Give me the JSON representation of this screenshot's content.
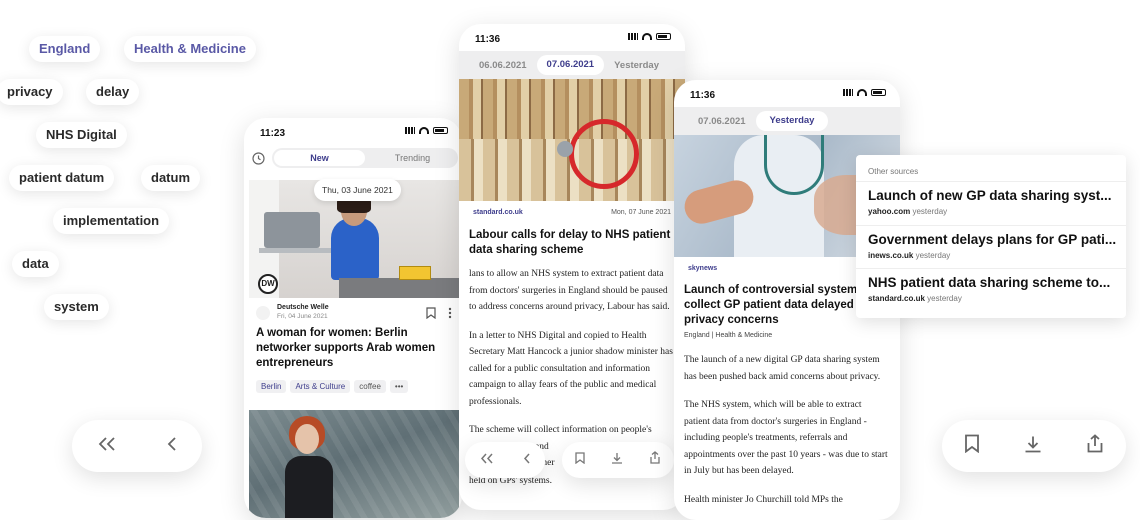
{
  "keywords": [
    "England",
    "Health & Medicine",
    "privacy",
    "delay",
    "NHS Digital",
    "patient datum",
    "datum",
    "implementation",
    "data",
    "system"
  ],
  "phone1": {
    "time": "11:23",
    "tabs": {
      "new": "New",
      "trending": "Trending"
    },
    "date_pill": "Thu, 03 June 2021",
    "source_name": "Deutsche Welle",
    "source_date": "Fri, 04 June 2021",
    "logo_text": "DW",
    "title": "A woman for women: Berlin networker supports Arab women entrepreneurs",
    "tags": [
      "Berlin",
      "Arts & Culture",
      "coffee",
      "•••"
    ]
  },
  "phone2": {
    "time": "11:36",
    "dates": [
      "06.06.2021",
      "07.06.2021",
      "Yesterday"
    ],
    "source": "standard.co.uk",
    "date": "Mon, 07 June 2021",
    "title": "Labour calls for delay to NHS patient data sharing scheme",
    "paragraphs": [
      "lans to allow an NHS system to extract patient data from doctors' surgeries in England should be paused to address concerns around privacy, Labour has said.",
      "In a letter to NHS Digital and copied to Health Secretary Matt Hancock a junior shadow minister has called for a public consultation and information campaign to allay fears of the public and medical professionals.",
      "The scheme will collect information on people's",
      "and",
      "other",
      "held on GPs' systems."
    ]
  },
  "phone3": {
    "time": "11:36",
    "dates": [
      "07.06.2021",
      "Yesterday"
    ],
    "source": "skynews",
    "title": "Launch of controversial system to collect GP patient data delayed a privacy concerns",
    "categories": "England | Health & Medicine",
    "paragraphs": [
      "The launch of a new digital GP data sharing system has been pushed back amid concerns about privacy.",
      "The NHS system, which will be able to extract patient data from doctor's surgeries in England - including people's treatments, referrals and appointments over the past 10 years - was due to start in July but has been delayed.",
      "Health minister Jo Churchill told MPs the"
    ]
  },
  "other_sources": {
    "heading": "Other sources",
    "items": [
      {
        "title": "Launch of new GP data sharing syst...",
        "source": "yahoo.com",
        "when": "yesterday"
      },
      {
        "title": "Government delays plans for GP pati...",
        "source": "inews.co.uk",
        "when": "yesterday"
      },
      {
        "title": "NHS patient data sharing scheme to...",
        "source": "standard.co.uk",
        "when": "yesterday"
      }
    ]
  },
  "colors": {
    "accent": "#3e3d8c",
    "keyword_accent": "#5a59a6"
  },
  "icons": [
    "double-chevron-left-icon",
    "chevron-left-icon",
    "bookmark-icon",
    "download-icon",
    "share-icon",
    "clock-icon",
    "more-vertical-icon"
  ]
}
